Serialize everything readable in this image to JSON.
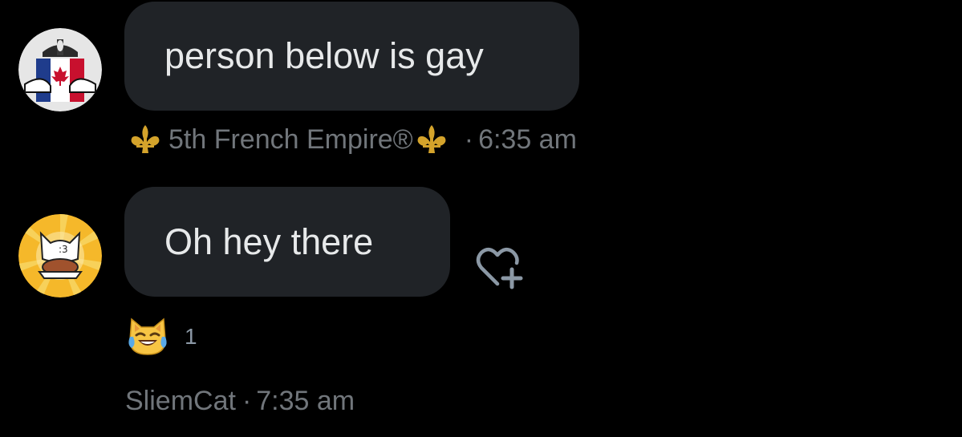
{
  "messages": [
    {
      "text": "person below is gay",
      "sender": "5th French Empire®",
      "separator": "·",
      "time": "6:35 am",
      "avatar_icon": "canada-flag-avatar-icon",
      "sender_decoration_icon": "fleur-de-lis-icon"
    },
    {
      "text": "Oh hey there",
      "sender": "SliemCat",
      "separator": "·",
      "time": "7:35 am",
      "avatar_icon": "cat-avatar-icon",
      "reaction": {
        "emoji_icon": "cat-tears-of-joy-emoji-icon",
        "count": "1"
      }
    }
  ],
  "add_reaction_icon": "heart-plus-icon",
  "colors": {
    "background": "#000000",
    "bubble": "#202327",
    "text": "#e7e9ea",
    "meta": "#71767b",
    "gold": "#d4a32b"
  }
}
